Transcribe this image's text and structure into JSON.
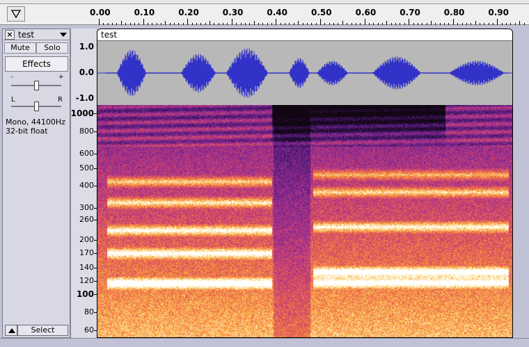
{
  "timeline": {
    "labels": [
      "0.00",
      "0.10",
      "0.20",
      "0.30",
      "0.40",
      "0.50",
      "0.60",
      "0.70",
      "0.80",
      "0.90"
    ]
  },
  "track_panel": {
    "name": "test",
    "mute_label": "Mute",
    "solo_label": "Solo",
    "effects_label": "Effects",
    "gain_minus": "-",
    "gain_plus": "+",
    "pan_left": "L",
    "pan_right": "R",
    "info_line1": "Mono, 44100Hz",
    "info_line2": "32-bit float",
    "select_label": "Select"
  },
  "track": {
    "tab_name": "test"
  },
  "waveform_scale": [
    "1.0",
    "0.0",
    "-1.0"
  ],
  "spectrogram_scale": [
    "1000",
    "800",
    "600",
    "500",
    "400",
    "300",
    "260",
    "200",
    "170",
    "140",
    "120",
    "100",
    "80",
    "60"
  ],
  "colors": {
    "waveform": "#3232c8",
    "wave_bg": "#b8b8b8",
    "spec_low": "#120612",
    "spec_high": "#ffffff"
  }
}
